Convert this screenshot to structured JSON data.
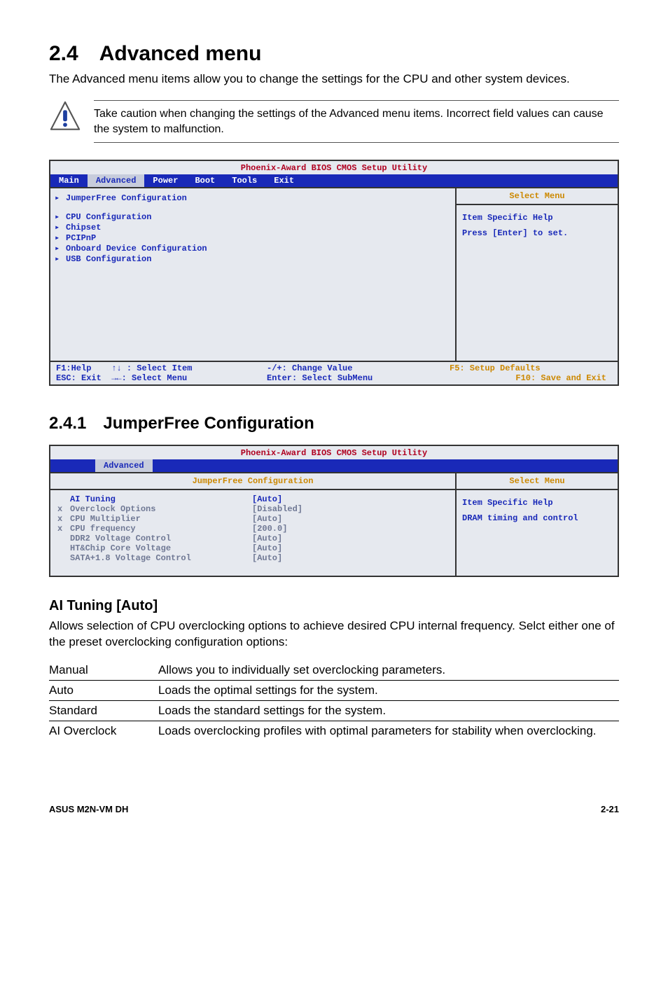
{
  "heading": {
    "num": "2.4",
    "title": "Advanced menu"
  },
  "intro": "The Advanced menu items allow you to change the settings for the CPU and other system devices.",
  "caution": "Take caution when changing the settings of the Advanced menu items. Incorrect field values can cause the system to malfunction.",
  "bios1": {
    "title": "Phoenix-Award BIOS CMOS Setup Utility",
    "tabs": [
      "Main",
      "Advanced",
      "Power",
      "Boot",
      "Tools",
      "Exit"
    ],
    "active_tab": "Advanced",
    "left_items": [
      {
        "label": "JumperFree Configuration",
        "arrow": true
      },
      {
        "spacer": true
      },
      {
        "label": "CPU Configuration",
        "arrow": true
      },
      {
        "label": "Chipset",
        "arrow": true
      },
      {
        "label": "PCIPnP",
        "arrow": true
      },
      {
        "label": "Onboard Device Configuration",
        "arrow": true
      },
      {
        "label": "USB Configuration",
        "arrow": true
      }
    ],
    "select_menu": "Select Menu",
    "help_title": "Item Specific Help",
    "help_body": "Press [Enter] to set.",
    "footer": {
      "f1": "F1:Help",
      "sel_item": "↑↓ : Select Item",
      "esc": "ESC: Exit",
      "sel_menu": "→←: Select Menu",
      "change": "-/+: Change Value",
      "enter": "Enter: Select SubMenu",
      "f5": "F5: Setup Defaults",
      "f10": "F10: Save and Exit"
    }
  },
  "sub": {
    "num": "2.4.1",
    "title": "JumperFree Configuration"
  },
  "bios2": {
    "title": "Phoenix-Award BIOS CMOS Setup Utility",
    "tab": "Advanced",
    "panel_title": "JumperFree Configuration",
    "select_menu": "Select Menu",
    "rows": [
      {
        "prefix": "",
        "label": "AI Tuning",
        "value": "[Auto]",
        "dim": false
      },
      {
        "prefix": "x",
        "label": "Overclock Options",
        "value": "[Disabled]",
        "dim": true
      },
      {
        "prefix": "x",
        "label": "CPU Multiplier",
        "value": "[Auto]",
        "dim": true
      },
      {
        "prefix": "x",
        "label": "CPU frequency",
        "value": "[200.0]",
        "dim": true
      },
      {
        "prefix": "",
        "label": "DDR2 Voltage Control",
        "value": "[Auto]",
        "dim": true
      },
      {
        "prefix": "",
        "label": "HT&Chip Core Voltage",
        "value": "[Auto]",
        "dim": true
      },
      {
        "prefix": "",
        "label": "SATA+1.8 Voltage Control",
        "value": "[Auto]",
        "dim": true
      }
    ],
    "help_title": "Item Specific Help",
    "help_body": "DRAM timing and control"
  },
  "ai": {
    "heading": "AI Tuning [Auto]",
    "body": "Allows selection of CPU overclocking options to achieve desired CPU internal frequency. Selct either one of the preset overclocking configuration options:",
    "opts": [
      {
        "k": "Manual",
        "v": "Allows you to individually set overclocking parameters."
      },
      {
        "k": "Auto",
        "v": "Loads the optimal settings for the system."
      },
      {
        "k": "Standard",
        "v": "Loads the standard settings for the system."
      },
      {
        "k": "AI Overclock",
        "v": "Loads overclocking profiles with optimal parameters for stability when overclocking."
      }
    ]
  },
  "footer": {
    "left": "ASUS M2N-VM DH",
    "right": "2-21"
  }
}
